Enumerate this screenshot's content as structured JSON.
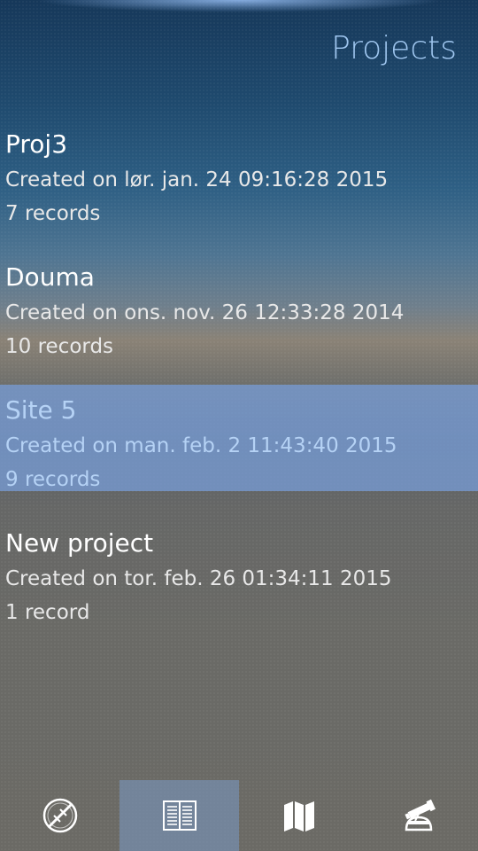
{
  "header": {
    "title": "Projects"
  },
  "projects": [
    {
      "name": "Proj3",
      "created": "Created on lør. jan. 24 09:16:28 2015",
      "records": "7 records",
      "selected": false
    },
    {
      "name": "Douma",
      "created": "Created on ons. nov. 26 12:33:28 2014",
      "records": "10 records",
      "selected": false
    },
    {
      "name": "Site 5",
      "created": "Created on man. feb. 2 11:43:40 2015",
      "records": "9 records",
      "selected": true
    },
    {
      "name": "New project",
      "created": "Created on tor. feb. 26 01:34:11 2015",
      "records": "1 record",
      "selected": false
    }
  ],
  "toolbar": {
    "items": [
      {
        "icon": "compass-icon",
        "active": false
      },
      {
        "icon": "records-list-icon",
        "active": true
      },
      {
        "icon": "map-icon",
        "active": false
      },
      {
        "icon": "telescope-icon",
        "active": false
      }
    ]
  },
  "colors": {
    "accent": "#9fc6ef",
    "selection": "#78a0dc",
    "text": "#ffffff"
  }
}
